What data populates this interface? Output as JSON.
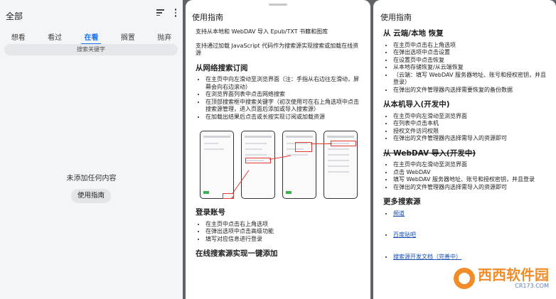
{
  "panel1": {
    "title": "全部",
    "tabs": [
      "想看",
      "看过",
      "在看",
      "搁置",
      "抛弃"
    ],
    "active_tab": "在看",
    "search_placeholder": "搜索关键字",
    "empty_text": "未添加任何内容",
    "guide_button": "使用指南"
  },
  "panel2": {
    "title": "使用指南",
    "intro1": "支持从本地和 WebDAV 导入 Epub/TXT 书籍和图库",
    "intro2": "支持通过加载 JavaScript 代码作为搜索源实现搜索或加载在线资源",
    "section1": {
      "heading": "从网络搜索订阅",
      "items": [
        "在主页中向左滑动至浏览界面（注：手指从右边往左滑动，屏幕会向右边滚动）",
        "在浏览界面列表中点击网络搜索",
        "在顶部搜索框中搜索关键字（初次使用可在右上角选项中点击搜索源管理，进入页面后添加或导入搜索源）",
        "在加载出结果后点击或长按实现订阅或加载资源"
      ]
    },
    "section2": {
      "heading": "登录账号",
      "items": [
        "在主页中点击右上角选项",
        "在弹出选项中点击高级功能",
        "填写对应信息进行登录"
      ]
    },
    "section3": {
      "heading": "在线搜索源实现一键添加"
    }
  },
  "panel3": {
    "title": "使用指南",
    "section1": {
      "heading": "从 云端/本地 恢复",
      "items": [
        "在主页中点击右上角选项",
        "在弹出选项中点击设置",
        "在设置页中点击恢复",
        "从本地存储恢复/从云端恢复",
        "（云端：填写 WebDAV 服务器地址、账号和授权密钥，并且登录）",
        "在弹出的文件管理器内选择需要恢复的备份数据"
      ]
    },
    "section2": {
      "heading": "从本机导入(开发中)",
      "items": [
        "在主页中向左滑动至浏览界面",
        "在列表中点击本机",
        "授权文件访问权限",
        "在弹出的文件管理器内选择需导入的资源即可"
      ]
    },
    "section3": {
      "heading": "从 WebDAV 导入(开发中)",
      "items": [
        "在主页中向左滑动至浏览界面",
        "点击 WebDAV",
        "填写 WebDAV 服务器地址、账号和授权密钥，并且登录",
        "在弹出的文件管理器内选择需导入的资源即可"
      ]
    },
    "section4": {
      "heading": "更多搜索源",
      "links": [
        "频道",
        "百度贴吧",
        "搜索源开发文档（完善中）"
      ]
    }
  },
  "watermark": {
    "logo_text": "西西软件园",
    "url": "CR173.COM"
  }
}
